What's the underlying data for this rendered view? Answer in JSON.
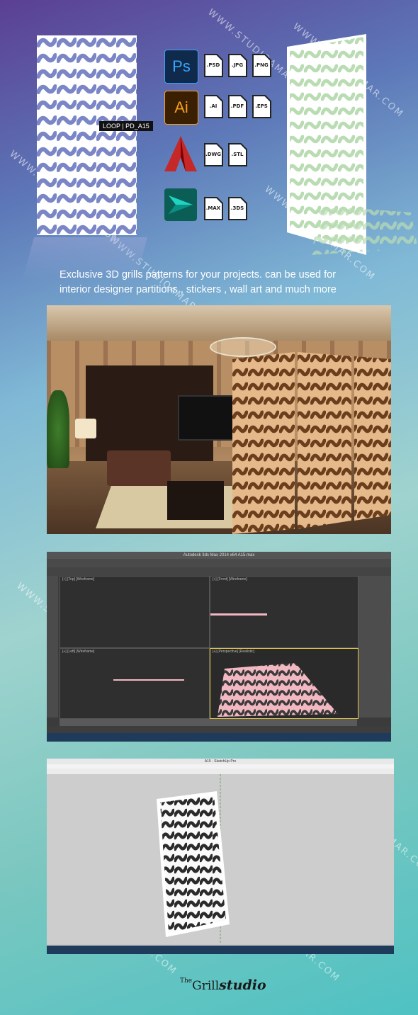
{
  "label_tag": "LOOP | PD_A15",
  "formats": {
    "photoshop": {
      "app": "Ps",
      "exts": [
        ".PSD",
        ".JPG",
        ".PNG"
      ]
    },
    "illustrator": {
      "app": "Ai",
      "exts": [
        ".AI",
        ".PDF",
        ".EPS"
      ]
    },
    "autocad": {
      "exts": [
        ".DWG",
        ".STL"
      ]
    },
    "max": {
      "exts": [
        ".MAX",
        ".3DS"
      ]
    }
  },
  "tagline": {
    "line1": "Exclusive  3D grills patterns for your projects.  can be used for",
    "line2": "interior designer partitions , stickers , wall art and much more"
  },
  "watermark": "WWW.STUDIOAMAR.COM",
  "max_window_title": "Autodesk 3ds Max 2014 x64   A15.max",
  "sketchup_window_title": "A15 - SketchUp Pro",
  "max_viewports": [
    "[+] [Top] [Wireframe]",
    "[+] [Front] [Wireframe]",
    "[+] [Left] [Wireframe]",
    "[+] [Perspective] [Realistic]"
  ],
  "brand": {
    "small": "The",
    "main": "Grill",
    "accent": "studio"
  },
  "colors": {
    "accent": "#f2b8c1",
    "brand": "#1a1a1a"
  }
}
